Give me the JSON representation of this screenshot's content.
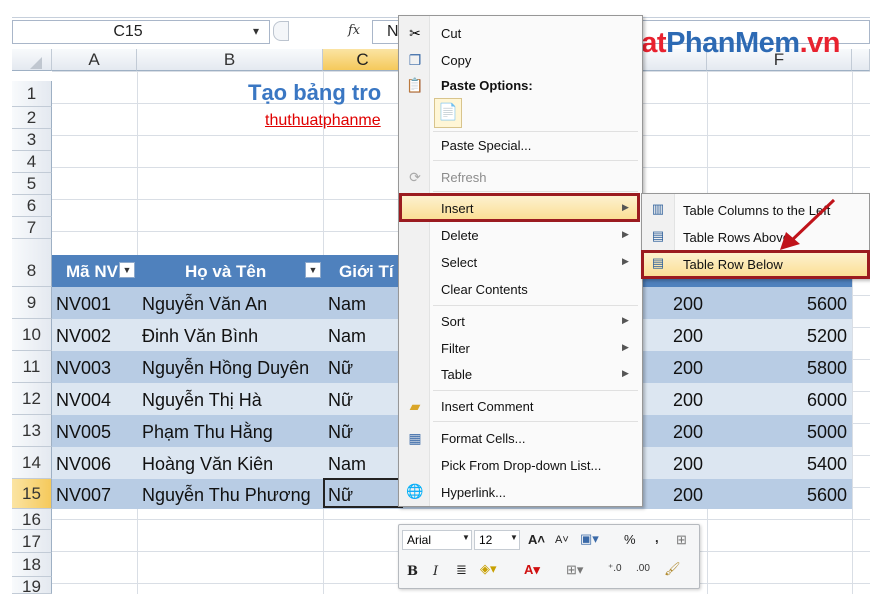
{
  "formula_bar": {
    "name_box": "C15",
    "name_box_arrow": "▾",
    "fx_label": "fx",
    "formula_value": "N"
  },
  "column_headers": [
    "A",
    "B",
    "C",
    "F"
  ],
  "row_numbers": [
    "1",
    "2",
    "3",
    "4",
    "5",
    "6",
    "7",
    "8",
    "9",
    "10",
    "11",
    "12",
    "13",
    "14",
    "15",
    "16",
    "17",
    "18",
    "19"
  ],
  "sheet": {
    "title": "Tạo bảng tro",
    "link": "thuthuatphanme",
    "table_headers": [
      "Mã NV",
      "Họ và Tên",
      "Giới Tí"
    ],
    "rows": [
      {
        "id": "NV001",
        "name": "Nguyễn Văn An",
        "gender": "Nam",
        "d": "200",
        "f": "5600"
      },
      {
        "id": "NV002",
        "name": "Đinh Văn Bình",
        "gender": "Nam",
        "d": "200",
        "f": "5200"
      },
      {
        "id": "NV003",
        "name": "Nguyễn Hồng Duyên",
        "gender": "Nữ",
        "d": "200",
        "f": "5800"
      },
      {
        "id": "NV004",
        "name": "Nguyễn Thị Hà",
        "gender": "Nữ",
        "d": "200",
        "f": "6000"
      },
      {
        "id": "NV005",
        "name": "Phạm Thu Hằng",
        "gender": "Nữ",
        "d": "200",
        "f": "5000"
      },
      {
        "id": "NV006",
        "name": "Hoàng Văn Kiên",
        "gender": "Nam",
        "d": "200",
        "f": "5400"
      },
      {
        "id": "NV007",
        "name": "Nguyễn Thu Phương",
        "gender": "Nữ",
        "d": "200",
        "f": "5600"
      }
    ]
  },
  "watermark": {
    "part1": "ThuThuat",
    "part2": "PhanMem",
    "part3": ".vn"
  },
  "context_menu": {
    "cut": "Cut",
    "copy": "Copy",
    "paste_options": "Paste Options:",
    "paste_special": "Paste Special...",
    "refresh": "Refresh",
    "insert": "Insert",
    "delete": "Delete",
    "select": "Select",
    "clear_contents": "Clear Contents",
    "sort": "Sort",
    "filter": "Filter",
    "table": "Table",
    "insert_comment": "Insert Comment",
    "format_cells": "Format Cells...",
    "pick_list": "Pick From Drop-down List...",
    "hyperlink": "Hyperlink..."
  },
  "submenu": {
    "columns_left": "Table Columns to the Left",
    "rows_above": "Table Rows Above",
    "row_below": "Table Row Below"
  },
  "mini_toolbar": {
    "font": "Arial",
    "size": "12",
    "percent": "%",
    "comma": ",",
    "bold": "B",
    "italic": "I"
  },
  "colors": {
    "header_blue": "#4f81bd",
    "band_dark": "#b8cce4",
    "band_light": "#dce6f1",
    "highlight_border": "#9b1b20",
    "watermark_red": "#e8222f",
    "watermark_blue": "#2d6ab4"
  }
}
